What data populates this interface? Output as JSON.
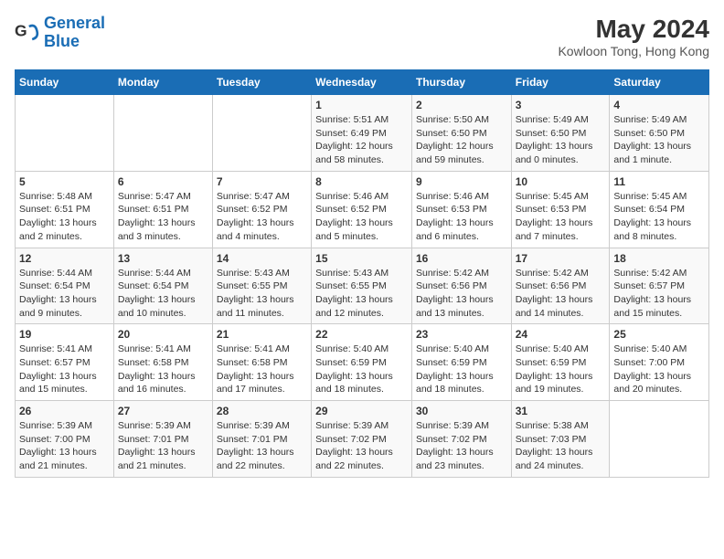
{
  "logo": {
    "name_part1": "General",
    "name_part2": "Blue"
  },
  "title": "May 2024",
  "subtitle": "Kowloon Tong, Hong Kong",
  "weekdays": [
    "Sunday",
    "Monday",
    "Tuesday",
    "Wednesday",
    "Thursday",
    "Friday",
    "Saturday"
  ],
  "weeks": [
    [
      {
        "day": "",
        "info": ""
      },
      {
        "day": "",
        "info": ""
      },
      {
        "day": "",
        "info": ""
      },
      {
        "day": "1",
        "info": "Sunrise: 5:51 AM\nSunset: 6:49 PM\nDaylight: 12 hours and 58 minutes."
      },
      {
        "day": "2",
        "info": "Sunrise: 5:50 AM\nSunset: 6:50 PM\nDaylight: 12 hours and 59 minutes."
      },
      {
        "day": "3",
        "info": "Sunrise: 5:49 AM\nSunset: 6:50 PM\nDaylight: 13 hours and 0 minutes."
      },
      {
        "day": "4",
        "info": "Sunrise: 5:49 AM\nSunset: 6:50 PM\nDaylight: 13 hours and 1 minute."
      }
    ],
    [
      {
        "day": "5",
        "info": "Sunrise: 5:48 AM\nSunset: 6:51 PM\nDaylight: 13 hours and 2 minutes."
      },
      {
        "day": "6",
        "info": "Sunrise: 5:47 AM\nSunset: 6:51 PM\nDaylight: 13 hours and 3 minutes."
      },
      {
        "day": "7",
        "info": "Sunrise: 5:47 AM\nSunset: 6:52 PM\nDaylight: 13 hours and 4 minutes."
      },
      {
        "day": "8",
        "info": "Sunrise: 5:46 AM\nSunset: 6:52 PM\nDaylight: 13 hours and 5 minutes."
      },
      {
        "day": "9",
        "info": "Sunrise: 5:46 AM\nSunset: 6:53 PM\nDaylight: 13 hours and 6 minutes."
      },
      {
        "day": "10",
        "info": "Sunrise: 5:45 AM\nSunset: 6:53 PM\nDaylight: 13 hours and 7 minutes."
      },
      {
        "day": "11",
        "info": "Sunrise: 5:45 AM\nSunset: 6:54 PM\nDaylight: 13 hours and 8 minutes."
      }
    ],
    [
      {
        "day": "12",
        "info": "Sunrise: 5:44 AM\nSunset: 6:54 PM\nDaylight: 13 hours and 9 minutes."
      },
      {
        "day": "13",
        "info": "Sunrise: 5:44 AM\nSunset: 6:54 PM\nDaylight: 13 hours and 10 minutes."
      },
      {
        "day": "14",
        "info": "Sunrise: 5:43 AM\nSunset: 6:55 PM\nDaylight: 13 hours and 11 minutes."
      },
      {
        "day": "15",
        "info": "Sunrise: 5:43 AM\nSunset: 6:55 PM\nDaylight: 13 hours and 12 minutes."
      },
      {
        "day": "16",
        "info": "Sunrise: 5:42 AM\nSunset: 6:56 PM\nDaylight: 13 hours and 13 minutes."
      },
      {
        "day": "17",
        "info": "Sunrise: 5:42 AM\nSunset: 6:56 PM\nDaylight: 13 hours and 14 minutes."
      },
      {
        "day": "18",
        "info": "Sunrise: 5:42 AM\nSunset: 6:57 PM\nDaylight: 13 hours and 15 minutes."
      }
    ],
    [
      {
        "day": "19",
        "info": "Sunrise: 5:41 AM\nSunset: 6:57 PM\nDaylight: 13 hours and 15 minutes."
      },
      {
        "day": "20",
        "info": "Sunrise: 5:41 AM\nSunset: 6:58 PM\nDaylight: 13 hours and 16 minutes."
      },
      {
        "day": "21",
        "info": "Sunrise: 5:41 AM\nSunset: 6:58 PM\nDaylight: 13 hours and 17 minutes."
      },
      {
        "day": "22",
        "info": "Sunrise: 5:40 AM\nSunset: 6:59 PM\nDaylight: 13 hours and 18 minutes."
      },
      {
        "day": "23",
        "info": "Sunrise: 5:40 AM\nSunset: 6:59 PM\nDaylight: 13 hours and 18 minutes."
      },
      {
        "day": "24",
        "info": "Sunrise: 5:40 AM\nSunset: 6:59 PM\nDaylight: 13 hours and 19 minutes."
      },
      {
        "day": "25",
        "info": "Sunrise: 5:40 AM\nSunset: 7:00 PM\nDaylight: 13 hours and 20 minutes."
      }
    ],
    [
      {
        "day": "26",
        "info": "Sunrise: 5:39 AM\nSunset: 7:00 PM\nDaylight: 13 hours and 21 minutes."
      },
      {
        "day": "27",
        "info": "Sunrise: 5:39 AM\nSunset: 7:01 PM\nDaylight: 13 hours and 21 minutes."
      },
      {
        "day": "28",
        "info": "Sunrise: 5:39 AM\nSunset: 7:01 PM\nDaylight: 13 hours and 22 minutes."
      },
      {
        "day": "29",
        "info": "Sunrise: 5:39 AM\nSunset: 7:02 PM\nDaylight: 13 hours and 22 minutes."
      },
      {
        "day": "30",
        "info": "Sunrise: 5:39 AM\nSunset: 7:02 PM\nDaylight: 13 hours and 23 minutes."
      },
      {
        "day": "31",
        "info": "Sunrise: 5:38 AM\nSunset: 7:03 PM\nDaylight: 13 hours and 24 minutes."
      },
      {
        "day": "",
        "info": ""
      }
    ]
  ]
}
